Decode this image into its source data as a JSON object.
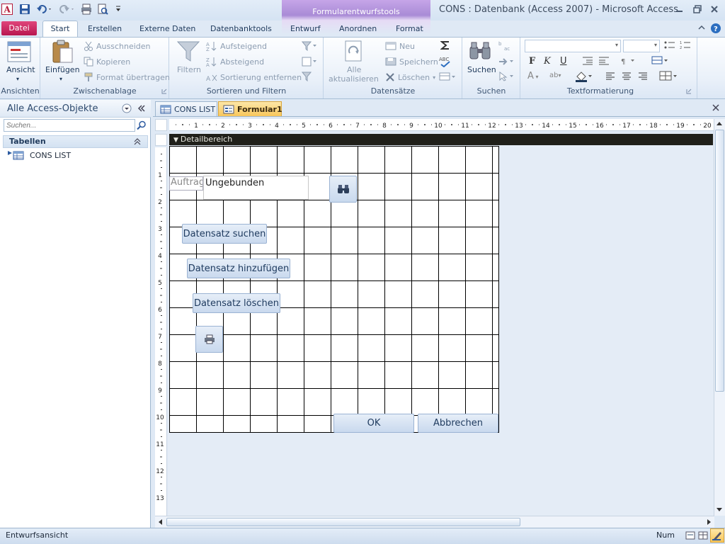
{
  "window": {
    "title": "CONS : Datenbank (Access 2007)  -  Microsoft Access",
    "contextual_group": "Formularentwurfstools"
  },
  "tabs": [
    "Datei",
    "Start",
    "Erstellen",
    "Externe Daten",
    "Datenbanktools",
    "Entwurf",
    "Anordnen",
    "Format"
  ],
  "ribbon": {
    "ansichten": {
      "label": "Ansichten",
      "ansicht": "Ansicht"
    },
    "zwischenablage": {
      "label": "Zwischenablage",
      "einfuegen": "Einfügen",
      "ausschneiden": "Ausschneiden",
      "kopieren": "Kopieren",
      "format": "Format übertragen"
    },
    "sortieren": {
      "label": "Sortieren und Filtern",
      "filtern": "Filtern",
      "aufsteigend": "Aufsteigend",
      "absteigend": "Absteigend",
      "entfernen": "Sortierung entfernen"
    },
    "datensaetze": {
      "label": "Datensätze",
      "alle1": "Alle",
      "alle2": "aktualisieren",
      "neu": "Neu",
      "speichern": "Speichern",
      "loeschen": "Löschen"
    },
    "suchen": {
      "label": "Suchen",
      "suchen": "Suchen"
    },
    "text": {
      "label": "Textformatierung"
    }
  },
  "nav": {
    "title": "Alle Access-Objekte",
    "search_placeholder": "Suchen...",
    "group": "Tabellen",
    "items": [
      "CONS LIST"
    ]
  },
  "doctabs": [
    "CONS LIST",
    "Formular1"
  ],
  "form": {
    "section": "Detailbereich",
    "label": "Auftrag",
    "textbox": "Ungebunden",
    "btn_search": "Datensatz suchen",
    "btn_add": "Datensatz hinzufügen",
    "btn_delete": "Datensatz löschen",
    "btn_ok": "OK",
    "btn_cancel": "Abbrechen"
  },
  "ruler": {
    "h": [
      "1",
      "2",
      "3",
      "4",
      "5",
      "6",
      "7",
      "8",
      "9",
      "10",
      "11",
      "12",
      "13",
      "14",
      "15",
      "16",
      "17",
      "18",
      "19",
      "20"
    ],
    "v": [
      "1",
      "2",
      "3",
      "4",
      "5",
      "6",
      "7",
      "8",
      "9",
      "10",
      "11",
      "12",
      "13"
    ]
  },
  "status": {
    "left": "Entwurfsansicht",
    "num": "Num"
  },
  "colors": {
    "datei": "#c8195a",
    "context": "#a98bd6",
    "accent": "#1e395b"
  }
}
